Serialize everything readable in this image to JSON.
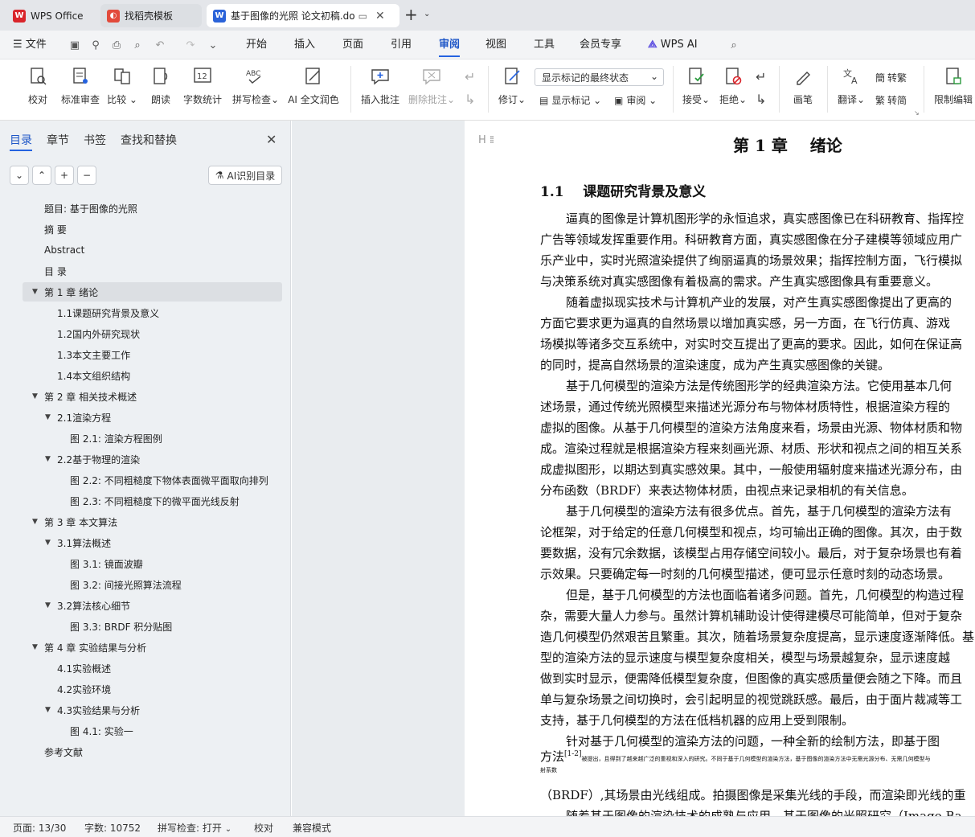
{
  "tabs": [
    {
      "label": "WPS Office"
    },
    {
      "label": "找稻壳模板"
    },
    {
      "label": "基于图像的光照 论文初稿.do"
    }
  ],
  "menu": {
    "file": "文件",
    "items": [
      "开始",
      "插入",
      "页面",
      "引用",
      "审阅",
      "视图",
      "工具",
      "会员专享",
      "WPS AI"
    ],
    "active_index": 4
  },
  "ribbon": {
    "proof": "校对",
    "standard_review": "标准审查",
    "compare": "比较",
    "read_aloud": "朗读",
    "word_count": "字数统计",
    "spellcheck": "拼写检查",
    "ai_polish": "AI 全文润色",
    "insert_comment": "插入批注",
    "delete_comment": "删除批注",
    "revise": "修订",
    "markup_select": "显示标记的最终状态",
    "show_markup": "显示标记",
    "review": "审阅",
    "accept": "接受",
    "reject": "拒绝",
    "pen": "画笔",
    "translate": "翻译",
    "to_traditional": "转繁",
    "to_simplified": "转简",
    "restrict_edit": "限制编辑"
  },
  "nav": {
    "tabs": [
      "目录",
      "章节",
      "书签",
      "查找和替换"
    ],
    "ai_toc": "AI识别目录",
    "toc": [
      {
        "text": "题目:   基于图像的光照",
        "level": 0,
        "arrow": ""
      },
      {
        "text": "摘 要",
        "level": 0,
        "arrow": ""
      },
      {
        "text": "Abstract",
        "level": 0,
        "arrow": ""
      },
      {
        "text": "目 录",
        "level": 0,
        "arrow": ""
      },
      {
        "text": "第 1 章  绪论",
        "level": 0,
        "arrow": "▼"
      },
      {
        "text": "1.1课题研究背景及意义",
        "level": 1,
        "arrow": ""
      },
      {
        "text": "1.2国内外研究现状",
        "level": 1,
        "arrow": ""
      },
      {
        "text": "1.3本文主要工作",
        "level": 1,
        "arrow": ""
      },
      {
        "text": "1.4本文组织结构",
        "level": 1,
        "arrow": ""
      },
      {
        "text": "第 2 章  相关技术概述",
        "level": 0,
        "arrow": "▼"
      },
      {
        "text": "2.1渲染方程",
        "level": 1,
        "arrow": "▼"
      },
      {
        "text": "图 2.1: 渲染方程图例",
        "level": 2,
        "arrow": ""
      },
      {
        "text": "2.2基于物理的渲染",
        "level": 1,
        "arrow": "▼"
      },
      {
        "text": "图 2.2: 不同粗糙度下物体表面微平面取向排列",
        "level": 2,
        "arrow": ""
      },
      {
        "text": "图 2.3: 不同粗糙度下的微平面光线反射",
        "level": 2,
        "arrow": ""
      },
      {
        "text": "第 3 章  本文算法",
        "level": 0,
        "arrow": "▼"
      },
      {
        "text": "3.1算法概述",
        "level": 1,
        "arrow": "▼"
      },
      {
        "text": "图 3.1: 镜面波瓣",
        "level": 2,
        "arrow": ""
      },
      {
        "text": "图 3.2: 间接光照算法流程",
        "level": 2,
        "arrow": ""
      },
      {
        "text": "3.2算法核心细节",
        "level": 1,
        "arrow": "▼"
      },
      {
        "text": "图 3.3: BRDF 积分贴图",
        "level": 2,
        "arrow": ""
      },
      {
        "text": "第 4 章  实验结果与分析",
        "level": 0,
        "arrow": "▼"
      },
      {
        "text": "4.1实验概述",
        "level": 1,
        "arrow": ""
      },
      {
        "text": "4.2实验环境",
        "level": 1,
        "arrow": ""
      },
      {
        "text": "4.3实验结果与分析",
        "level": 1,
        "arrow": "▼"
      },
      {
        "text": "图 4.1: 实验一",
        "level": 2,
        "arrow": ""
      },
      {
        "text": "参考文献",
        "level": 0,
        "arrow": ""
      }
    ],
    "selected_index": 4
  },
  "doc": {
    "chapter_title": "第 1 章    绪论",
    "section_num": "1.1",
    "section_title": "课题研究背景及意义",
    "lines": [
      {
        "text": "逼真的图像是计算机图形学的永恒追求，真实感图像已在科研教育、指挥控",
        "indent": true
      },
      {
        "text": "广告等领域发挥重要作用。科研教育方面，真实感图像在分子建模等领域应用广",
        "indent": false
      },
      {
        "text": "乐产业中，实时光照渲染提供了绚丽逼真的场景效果；指挥控制方面，飞行模拟",
        "indent": false
      },
      {
        "text": "与决策系统对真实感图像有着极高的需求。产生真实感图像具有重要意义。",
        "indent": false
      },
      {
        "text": "随着虚拟现实技术与计算机产业的发展，对产生真实感图像提出了更高的",
        "indent": true
      },
      {
        "text": "方面它要求更为逼真的自然场景以增加真实感，另一方面，在飞行仿真、游戏",
        "indent": false
      },
      {
        "text": "场模拟等诸多交互系统中，对实时交互提出了更高的要求。因此，如何在保证高",
        "indent": false
      },
      {
        "text": "的同时，提高自然场景的渲染速度，成为产生真实感图像的关键。",
        "indent": false
      },
      {
        "text": "基于几何模型的渲染方法是传统图形学的经典渲染方法。它使用基本几何",
        "indent": true
      },
      {
        "text": "述场景，通过传统光照模型来描述光源分布与物体材质特性，根据渲染方程的",
        "indent": false
      },
      {
        "text": "虚拟的图像。从基于几何模型的渲染方法角度来看，场景由光源、物体材质和物",
        "indent": false
      },
      {
        "text": "成。渲染过程就是根据渲染方程来刻画光源、材质、形状和视点之间的相互关系",
        "indent": false
      },
      {
        "text": "成虚拟图形，以期达到真实感效果。其中，一般使用辐射度来描述光源分布，由",
        "indent": false
      },
      {
        "text": "分布函数（BRDF）来表达物体材质，由视点来记录相机的有关信息。",
        "indent": false
      },
      {
        "text": "基于几何模型的渲染方法有很多优点。首先，基于几何模型的渲染方法有",
        "indent": true
      },
      {
        "text": "论框架，对于给定的任意几何模型和视点，均可输出正确的图像。其次，由于数",
        "indent": false
      },
      {
        "text": "要数据，没有冗余数据，该模型占用存储空间较小。最后，对于复杂场景也有着",
        "indent": false
      },
      {
        "text": "示效果。只要确定每一时刻的几何模型描述，便可显示任意时刻的动态场景。",
        "indent": false
      },
      {
        "text": "但是，基于几何模型的方法也面临着诸多问题。首先，几何模型的构造过程",
        "indent": true
      },
      {
        "text": "杂，需要大量人力参与。虽然计算机辅助设计使得建模尽可能简单，但对于复杂",
        "indent": false
      },
      {
        "text": "造几何模型仍然艰苦且繁重。其次，随着场景复杂度提高，显示速度逐渐降低。基",
        "indent": false
      },
      {
        "text": "型的渲染方法的显示速度与模型复杂度相关，模型与场景越复杂，显示速度越",
        "indent": false
      },
      {
        "text": "做到实时显示，便需降低模型复杂度，但图像的真实感质量便会随之下降。而且",
        "indent": false
      },
      {
        "text": "单与复杂场景之间切换时，会引起明显的视觉跳跃感。最后，由于面片裁减等工",
        "indent": false
      },
      {
        "text": "支持，基于几何模型的方法在低档机器的应用上受到限制。",
        "indent": false
      },
      {
        "text": "针对基于几何模型的渲染方法的问题，一种全新的绘制方法，即基于图",
        "indent": true
      }
    ],
    "tail_prefix": "方法",
    "tail_cite": "[1-2]",
    "tail_note": "被提出，且得到了越来越广泛的重视和深入的研究。不同于基于几何模型的渲染方法，基于图像的渲染方法中无需光源分布、无需几何模型与",
    "tail_note2": "射系数",
    "line_after": "（BRDF）,其场景由光线组成。拍摄图像是采集光线的手段，而渲染即光线的重",
    "line_cut": "随着基于图像的渲染技术的成熟与应用，基于图像的光照研究（Image-Ba"
  },
  "status": {
    "page": "页面: 13/30",
    "words": "字数: 10752",
    "spell": "拼写检查: 打开",
    "proof": "校对",
    "compat": "兼容模式"
  },
  "colors": {
    "accent": "#2462e0",
    "active_tab_underline": "#2462e0"
  }
}
